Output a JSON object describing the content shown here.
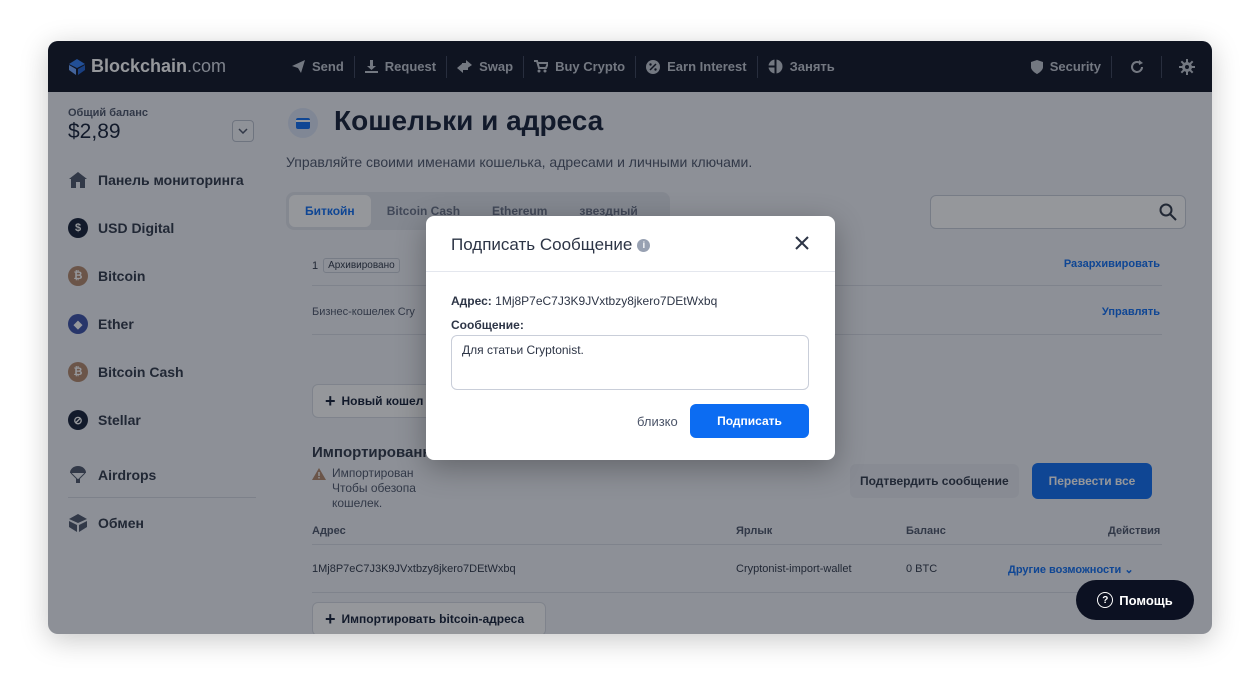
{
  "brand": {
    "name": "Blockchain",
    "suffix": ".com"
  },
  "nav": {
    "items": [
      "Send",
      "Request",
      "Swap",
      "Buy Crypto",
      "Earn Interest",
      "Занять"
    ],
    "security": "Security"
  },
  "sidebar": {
    "balance_label": "Общий баланс",
    "balance_value": "$2,89",
    "items": [
      {
        "label": "Панель мониторинга",
        "icon": "home-icon"
      },
      {
        "label": "USD Digital",
        "icon": "usd-digital-icon"
      },
      {
        "label": "Bitcoin",
        "icon": "bitcoin-icon"
      },
      {
        "label": "Ether",
        "icon": "ether-icon"
      },
      {
        "label": "Bitcoin Cash",
        "icon": "bitcoin-cash-icon"
      },
      {
        "label": "Stellar",
        "icon": "stellar-icon"
      },
      {
        "label": "Airdrops",
        "icon": "airdrops-icon"
      },
      {
        "label": "Обмен",
        "icon": "exchange-icon"
      }
    ]
  },
  "main": {
    "title": "Кошельки и адреса",
    "subtitle": "Управляйте своими именами кошелька, адресами и личными ключами.",
    "tabs": [
      "Биткойн",
      "Bitcoin Cash",
      "Ethereum",
      "звездный"
    ],
    "archived_count": "1",
    "archived_badge": "Архивировано",
    "unarchive_link": "Разархивировать",
    "wallet_name": "Бизнес-кошелек Cry",
    "manage_link": "Управлять",
    "new_wallet_button": "Новый кошел",
    "imported_title": "Импортированны",
    "warning_lines": [
      "Импортирован",
      "Чтобы обезопа",
      "кошелек."
    ],
    "verify_button": "Подтвердить сообщение",
    "transfer_button": "Перевести все",
    "table": {
      "headers": [
        "Адрес",
        "Ярлык",
        "Баланс",
        "Действия"
      ],
      "row": {
        "address": "1Mj8P7eC7J3K9JVxtbzy8jkero7DEtWxbq",
        "label": "Cryptonist-import-wallet",
        "balance": "0 BTC",
        "actions": "Другие возможности"
      }
    },
    "import_button": "Импортировать bitcoin-адреса"
  },
  "help_button": "Помощь",
  "modal": {
    "title": "Подписать Сообщение",
    "address_label": "Адрес:",
    "address_value": "1Mj8P7eC7J3K9JVxtbzy8jkero7DEtWxbq",
    "message_label": "Сообщение:",
    "message_value": "Для статьи Cryptonist.",
    "close_button": "близко",
    "sign_button": "Подписать"
  },
  "colors": {
    "accent": "#0c6cf2",
    "nav_bg": "#0c1122"
  }
}
